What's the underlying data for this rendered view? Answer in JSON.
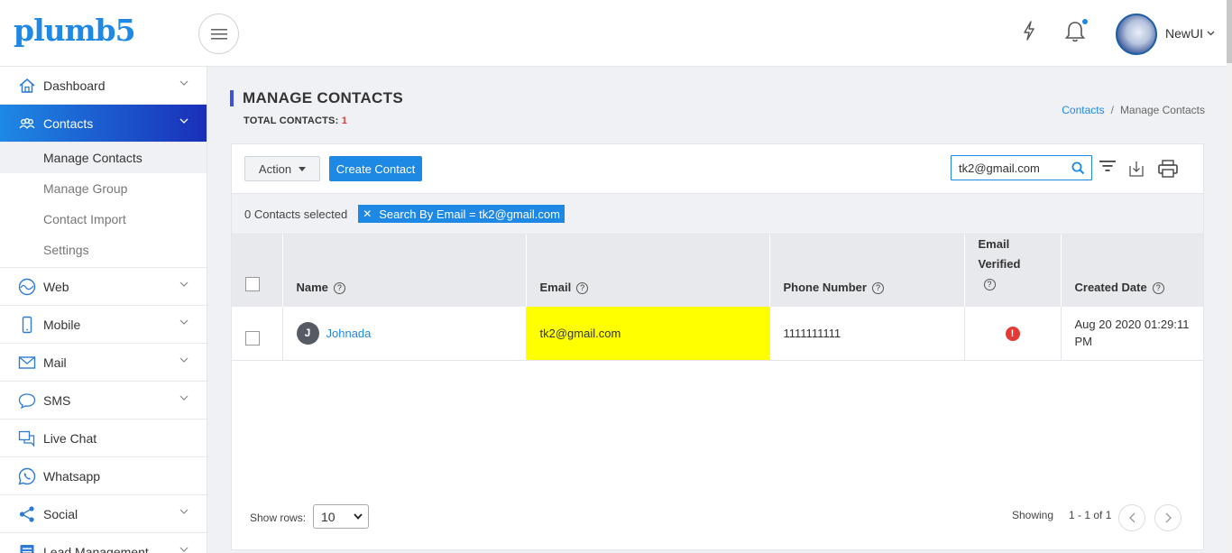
{
  "app": {
    "logo": "plumb5"
  },
  "header": {
    "user_name": "NewUI"
  },
  "sidebar": {
    "items": [
      {
        "label": "Dashboard",
        "icon": "home-icon"
      },
      {
        "label": "Contacts",
        "icon": "contacts-icon",
        "active": true,
        "subitems": [
          {
            "label": "Manage Contacts",
            "current": true
          },
          {
            "label": "Manage Group"
          },
          {
            "label": "Contact Import"
          },
          {
            "label": "Settings"
          }
        ]
      },
      {
        "label": "Web",
        "icon": "web-icon"
      },
      {
        "label": "Mobile",
        "icon": "mobile-icon"
      },
      {
        "label": "Mail",
        "icon": "mail-icon"
      },
      {
        "label": "SMS",
        "icon": "sms-icon"
      },
      {
        "label": "Live Chat",
        "icon": "live-chat-icon"
      },
      {
        "label": "Whatsapp",
        "icon": "whatsapp-icon"
      },
      {
        "label": "Social",
        "icon": "share-icon"
      },
      {
        "label": "Lead Management",
        "icon": "lead-icon"
      }
    ]
  },
  "page": {
    "title": "MANAGE CONTACTS",
    "total_label": "TOTAL CONTACTS:",
    "total_count": "1",
    "breadcrumb": {
      "parent": "Contacts",
      "separator": "/",
      "current": "Manage Contacts"
    }
  },
  "toolbar": {
    "action_label": "Action",
    "create_label": "Create Contact",
    "search_value": "tk2@gmail.com"
  },
  "selection": {
    "selected_text": "0 Contacts selected",
    "filter_chip": "Search By Email = tk2@gmail.com"
  },
  "table": {
    "columns": [
      "Name",
      "Email",
      "Phone Number",
      "Email Verified",
      "Created Date"
    ],
    "rows": [
      {
        "initial": "J",
        "name": "Johnada",
        "email": "tk2@gmail.com",
        "phone": "1111111111",
        "verified_icon": "!",
        "created": "Aug 20 2020 01:29:11 PM"
      }
    ]
  },
  "footer": {
    "show_rows_label": "Show rows:",
    "rows_value": "10",
    "showing_label": "Showing",
    "range": "1 - 1 of 1"
  },
  "colors": {
    "accent": "#1e88e5",
    "sidebar_active_end": "#1a2fb8",
    "highlight": "#ffff00",
    "danger": "#e53935"
  }
}
